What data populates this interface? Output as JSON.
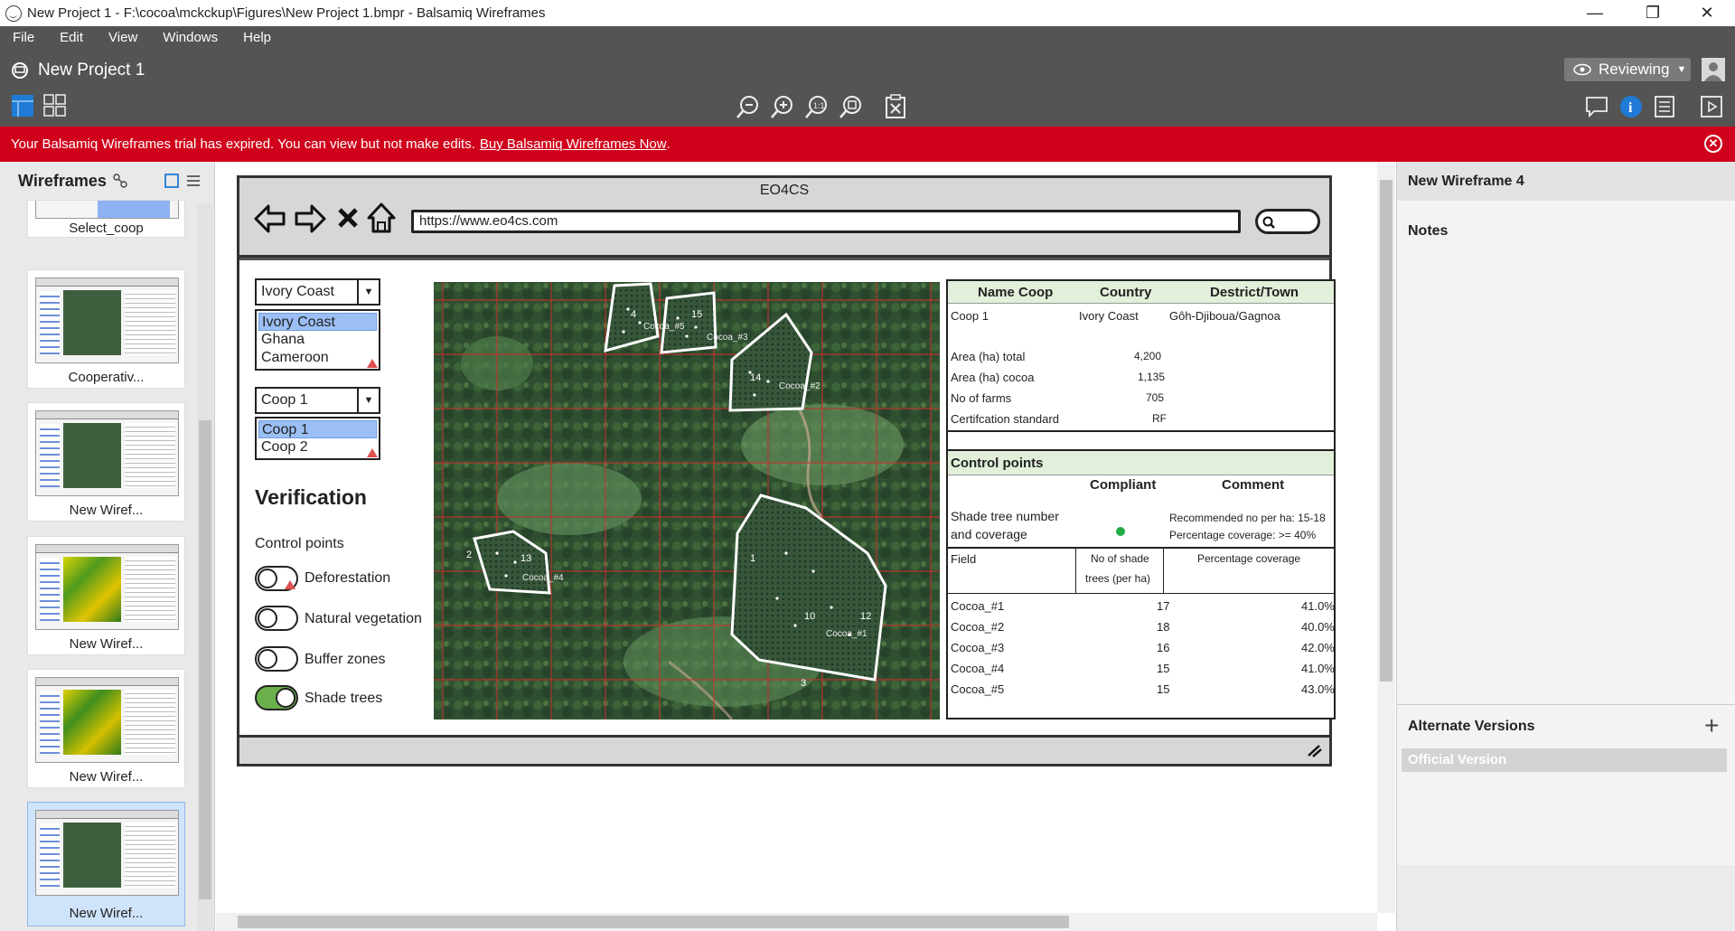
{
  "window": {
    "title": "New Project 1 - F:\\cocoa\\mckckup\\Figures\\New Project 1.bmpr - Balsamiq Wireframes",
    "minimize": "—",
    "restore": "❐",
    "close": "✕"
  },
  "menu": [
    "File",
    "Edit",
    "View",
    "Windows",
    "Help"
  ],
  "toolbar": {
    "project_name": "New Project 1",
    "review_label": "Reviewing",
    "zoom_icons": [
      "zoom-out-icon",
      "zoom-in-icon",
      "zoom-actual-icon",
      "zoom-fit-icon",
      "clear-icon"
    ]
  },
  "banner": {
    "message": "Your Balsamiq Wireframes trial has expired. You can view but not make edits.",
    "link": "Buy Balsamiq Wireframes Now",
    "suffix": ".",
    "color": "#d0021b"
  },
  "left_panel": {
    "title": "Wireframes",
    "thumbnails": [
      {
        "label": "Select_coop"
      },
      {
        "label": "Cooperativ..."
      },
      {
        "label": "New Wiref..."
      },
      {
        "label": "New Wiref..."
      },
      {
        "label": "New Wiref..."
      },
      {
        "label": "New Wiref..."
      }
    ]
  },
  "mockup": {
    "browser_title": "EO4CS",
    "url": "https://www.eo4cs.com",
    "search_glyph": "🔍",
    "country_combo": {
      "value": "Ivory Coast",
      "options": [
        "Ivory Coast",
        "Ghana",
        "Cameroon"
      ]
    },
    "coop_combo": {
      "value": "Coop 1",
      "options": [
        "Coop 1",
        "Coop 2"
      ]
    },
    "heading": "Verification",
    "control_points_label": "Control points",
    "toggles": [
      {
        "label": "Deforestation",
        "on": false
      },
      {
        "label": "Natural vegetation",
        "on": false
      },
      {
        "label": "Buffer zones",
        "on": false
      },
      {
        "label": "Shade trees",
        "on": true
      }
    ],
    "map_labels": {
      "plots": [
        "Cocoa_#1",
        "Cocoa_#2",
        "Cocoa_#3",
        "Cocoa_#4",
        "Cocoa_#5"
      ],
      "numbers": [
        "4",
        "15",
        "14",
        "13",
        "1",
        "10",
        "12",
        "3",
        "2"
      ]
    },
    "info": {
      "headers": [
        "Name Coop",
        "Country",
        "Destrict/Town"
      ],
      "row": [
        "Coop 1",
        "Ivory Coast",
        "Gôh-Djiboua/Gagnoa"
      ],
      "stats": [
        {
          "label": "Area (ha) total",
          "value": "4,200"
        },
        {
          "label": "Area (ha) cocoa",
          "value": "1,135"
        },
        {
          "label": "No of farms",
          "value": "705"
        },
        {
          "label": "Certifcation standard",
          "value": "RF"
        }
      ],
      "control_points_title": "Control points",
      "compliant_header": "Compliant",
      "comment_header": "Comment",
      "check_name_1": "Shade tree number",
      "check_name_2": "and coverage",
      "comment_1": "Recommended no per ha: 15-18",
      "comment_2": "Percentage coverage: >= 40%",
      "field_headers": {
        "field": "Field",
        "shade_1": "No of shade",
        "shade_2": "trees (per ha)",
        "coverage": "Percentage coverage"
      },
      "fields": [
        {
          "name": "Cocoa_#1",
          "trees": "17",
          "coverage": "41.0%"
        },
        {
          "name": "Cocoa_#2",
          "trees": "18",
          "coverage": "40.0%"
        },
        {
          "name": "Cocoa_#3",
          "trees": "16",
          "coverage": "42.0%"
        },
        {
          "name": "Cocoa_#4",
          "trees": "15",
          "coverage": "41.0%"
        },
        {
          "name": "Cocoa_#5",
          "trees": "15",
          "coverage": "43.0%"
        }
      ],
      "compliant_color": "#22aa44"
    }
  },
  "right_panel": {
    "title": "New Wireframe 4",
    "notes_label": "Notes",
    "alternate_label": "Alternate Versions",
    "official_label": "Official Version"
  }
}
